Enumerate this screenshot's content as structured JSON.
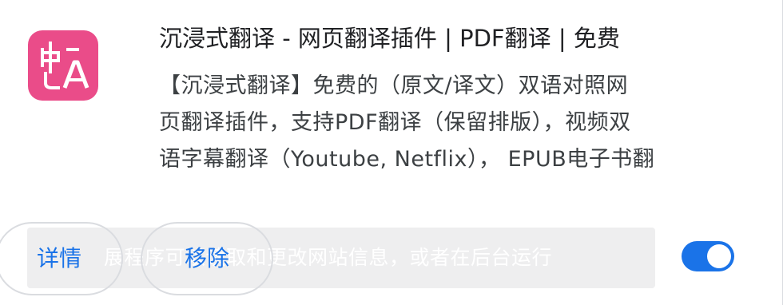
{
  "extension": {
    "title": "沉浸式翻译 - 网页翻译插件 | PDF翻译 | 免费",
    "description_lines": [
      "【沉浸式翻译】免费的（原文/译文）双语对照网",
      "页翻译插件，支持PDF翻译（保留排版），视频双",
      "语字幕翻译（Youtube, Netflix）， EPUB电子书翻"
    ],
    "icon_name": "translate-icon",
    "icon_text": "中A",
    "brand_color": "#ea4c89"
  },
  "actions": {
    "details_label": "详情",
    "remove_label": "移除"
  },
  "permission": {
    "text": "展程序可以读取和更改网站信息，或者在后台运行"
  },
  "toggle": {
    "enabled": true,
    "accent_color": "#1a73e8"
  }
}
